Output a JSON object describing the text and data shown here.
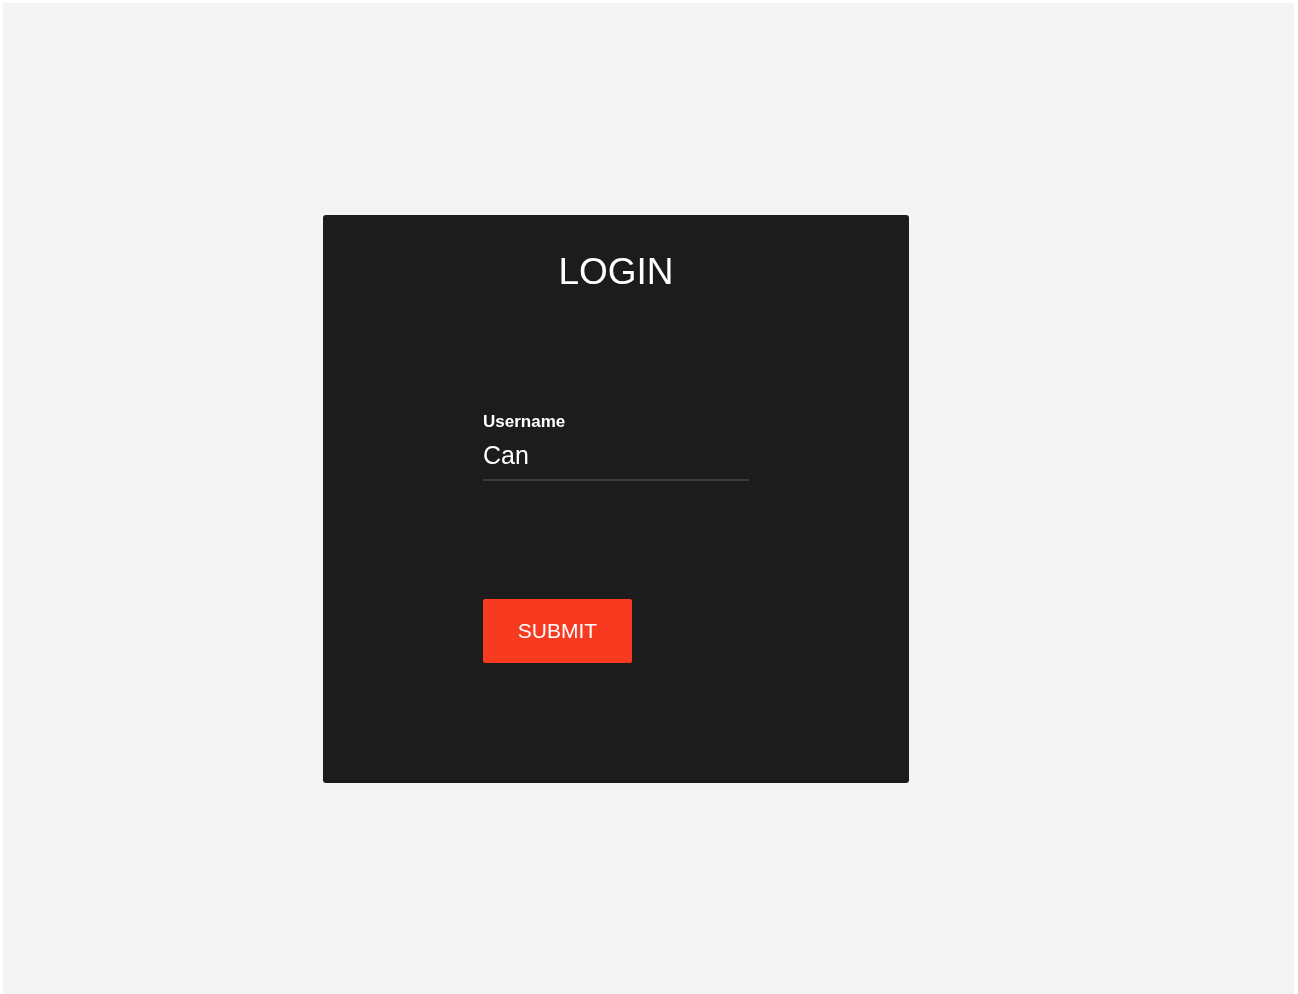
{
  "login_card": {
    "title": "LOGIN",
    "username_field": {
      "label": "Username",
      "value": "Can"
    },
    "submit_button": {
      "label": "SUBMIT"
    }
  }
}
